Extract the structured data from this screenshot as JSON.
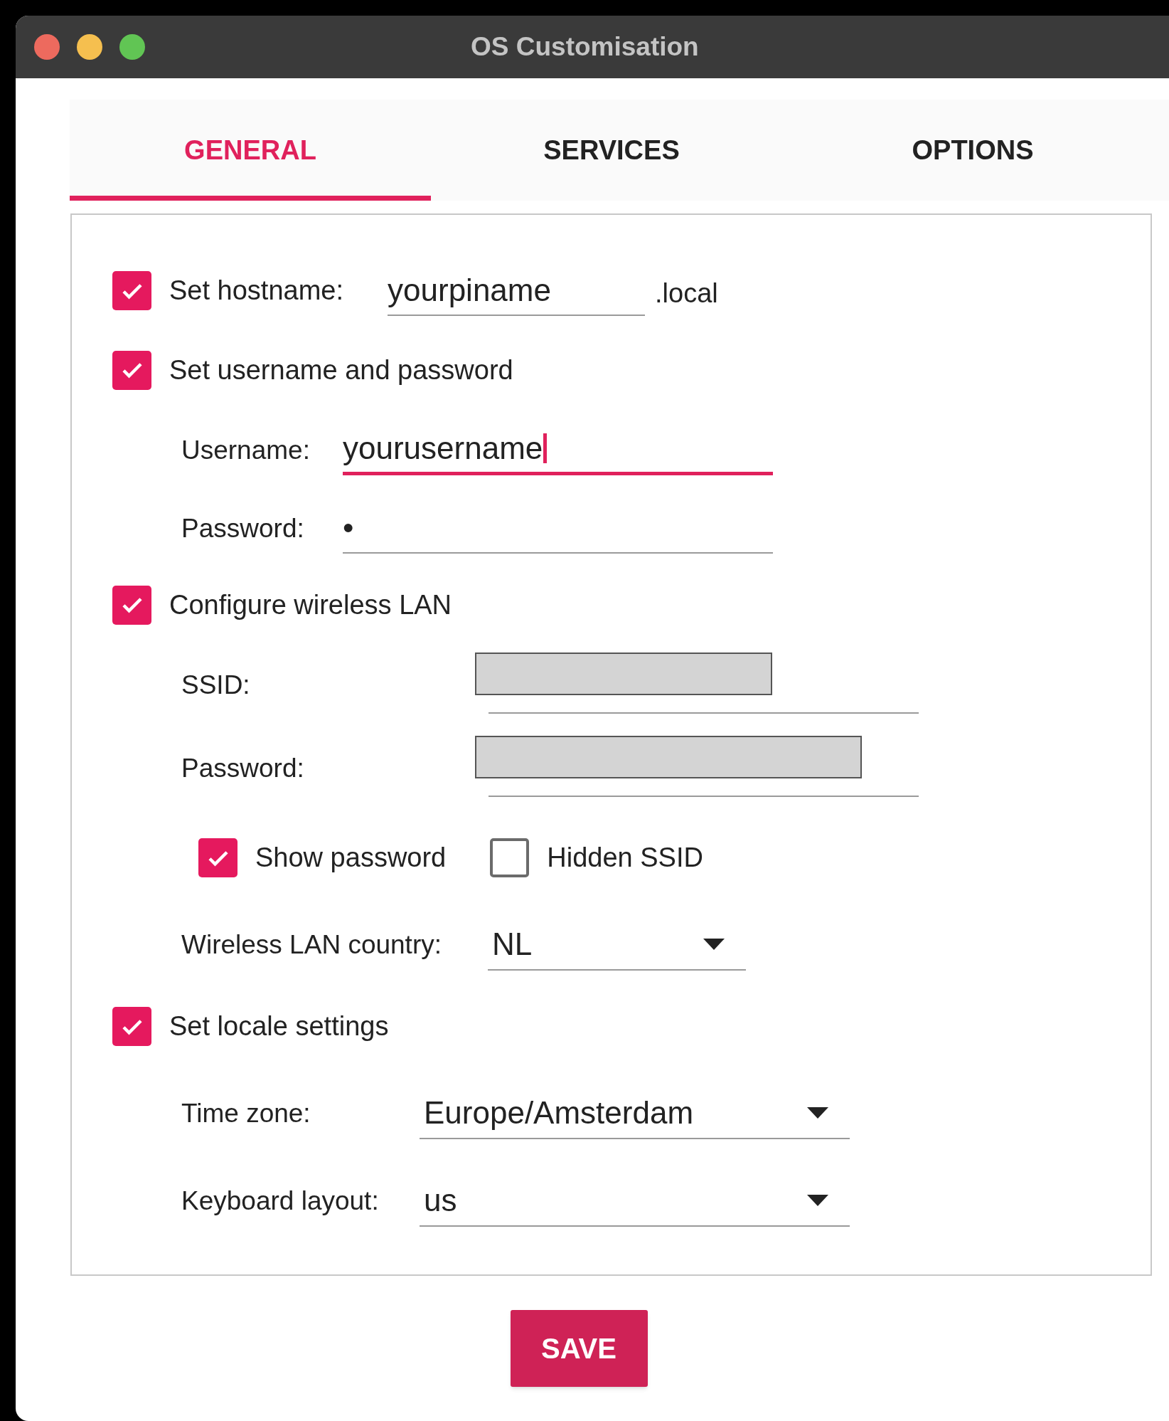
{
  "window": {
    "title": "OS Customisation"
  },
  "tabs": [
    {
      "label": "GENERAL",
      "selected": true
    },
    {
      "label": "SERVICES",
      "selected": false
    },
    {
      "label": "OPTIONS",
      "selected": false
    }
  ],
  "general": {
    "hostname": {
      "checked": true,
      "label": "Set hostname:",
      "value": "yourpiname",
      "suffix": ".local"
    },
    "user": {
      "checked": true,
      "label": "Set username and password",
      "username": {
        "label": "Username:",
        "value": "yourusername",
        "focused": true
      },
      "password": {
        "label": "Password:",
        "value": "•",
        "focused": false
      }
    },
    "wireless": {
      "checked": true,
      "label": "Configure wireless LAN",
      "ssid": {
        "label": "SSID:",
        "redacted": true
      },
      "password": {
        "label": "Password:",
        "redacted": true
      },
      "show_password": {
        "label": "Show password",
        "checked": true
      },
      "hidden_ssid": {
        "label": "Hidden SSID",
        "checked": false
      },
      "country": {
        "label": "Wireless LAN country:",
        "value": "NL"
      }
    },
    "locale": {
      "checked": true,
      "label": "Set locale settings",
      "timezone": {
        "label": "Time zone:",
        "value": "Europe/Amsterdam"
      },
      "keyboard": {
        "label": "Keyboard layout:",
        "value": "us"
      }
    }
  },
  "save_button": "SAVE"
}
